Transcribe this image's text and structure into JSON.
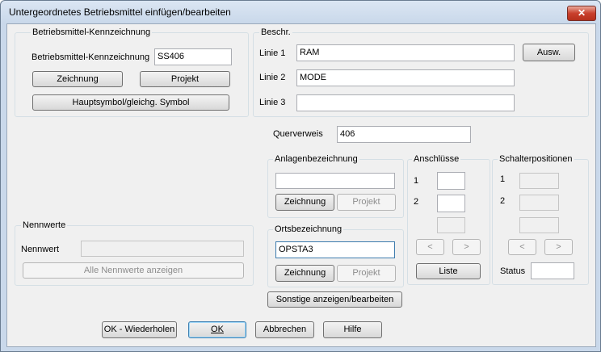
{
  "window": {
    "title": "Untergeordnetes Betriebsmittel einfügen/bearbeiten",
    "close_glyph": "✕"
  },
  "kennzeichnung": {
    "group_label": "Betriebsmittel-Kennzeichnung",
    "field_label": "Betriebsmittel-Kennzeichnung",
    "field_value": "SS406",
    "zeichnung_button": "Zeichnung",
    "projekt_button": "Projekt",
    "hauptsymbol_button": "Hauptsymbol/gleichg. Symbol"
  },
  "beschr": {
    "group_label": "Beschr.",
    "lines": [
      {
        "label": "Linie 1",
        "value": "RAM"
      },
      {
        "label": "Linie 2",
        "value": "MODE"
      },
      {
        "label": "Linie 3",
        "value": ""
      }
    ],
    "ausw_button": "Ausw."
  },
  "querverweis": {
    "label": "Querverweis",
    "value": "406"
  },
  "anlagen": {
    "group_label": "Anlagenbezeichnung",
    "value": "",
    "zeichnung_button": "Zeichnung",
    "projekt_button": "Projekt"
  },
  "orts": {
    "group_label": "Ortsbezeichnung",
    "value": "OPSTA3",
    "zeichnung_button": "Zeichnung",
    "projekt_button": "Projekt"
  },
  "anschluesse": {
    "group_label": "Anschlüsse",
    "row1": "1",
    "row2": "2",
    "prev": "<",
    "next": ">",
    "liste_button": "Liste"
  },
  "schalter": {
    "group_label": "Schalterpositionen",
    "row1": "1",
    "row2": "2",
    "prev": "<",
    "next": ">",
    "status_label": "Status",
    "status_value": ""
  },
  "nennwerte": {
    "group_label": "Nennwerte",
    "field_label": "Nennwert",
    "field_value": "",
    "show_all_button": "Alle Nennwerte anzeigen"
  },
  "sonstige_button": "Sonstige anzeigen/bearbeiten",
  "footer": {
    "ok_repeat": "OK - Wiederholen",
    "ok": "OK",
    "cancel": "Abbrechen",
    "help": "Hilfe"
  }
}
